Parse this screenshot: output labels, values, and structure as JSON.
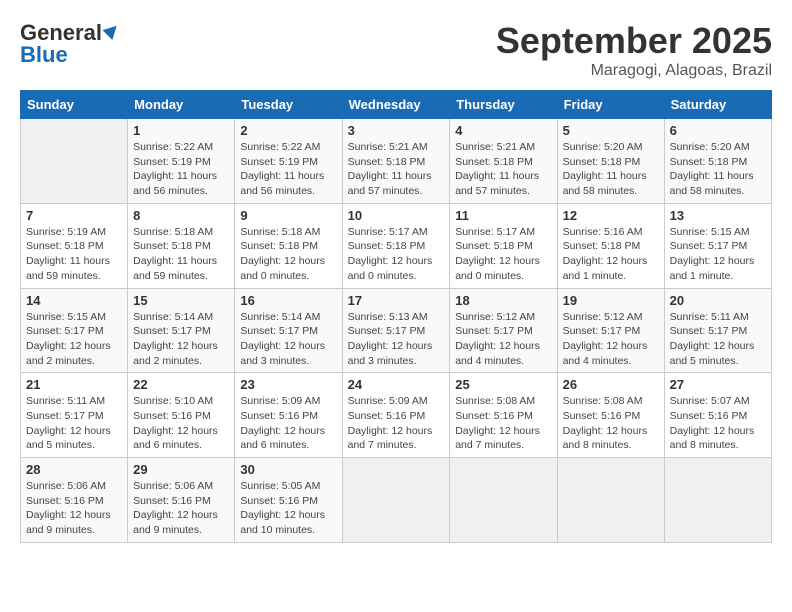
{
  "header": {
    "logo_general": "General",
    "logo_blue": "Blue",
    "month_title": "September 2025",
    "location": "Maragogi, Alagoas, Brazil"
  },
  "columns": [
    "Sunday",
    "Monday",
    "Tuesday",
    "Wednesday",
    "Thursday",
    "Friday",
    "Saturday"
  ],
  "weeks": [
    [
      {
        "day": "",
        "sunrise": "",
        "sunset": "",
        "daylight": ""
      },
      {
        "day": "1",
        "sunrise": "5:22 AM",
        "sunset": "5:19 PM",
        "daylight": "11 hours and 56 minutes."
      },
      {
        "day": "2",
        "sunrise": "5:22 AM",
        "sunset": "5:19 PM",
        "daylight": "11 hours and 56 minutes."
      },
      {
        "day": "3",
        "sunrise": "5:21 AM",
        "sunset": "5:18 PM",
        "daylight": "11 hours and 57 minutes."
      },
      {
        "day": "4",
        "sunrise": "5:21 AM",
        "sunset": "5:18 PM",
        "daylight": "11 hours and 57 minutes."
      },
      {
        "day": "5",
        "sunrise": "5:20 AM",
        "sunset": "5:18 PM",
        "daylight": "11 hours and 58 minutes."
      },
      {
        "day": "6",
        "sunrise": "5:20 AM",
        "sunset": "5:18 PM",
        "daylight": "11 hours and 58 minutes."
      }
    ],
    [
      {
        "day": "7",
        "sunrise": "5:19 AM",
        "sunset": "5:18 PM",
        "daylight": "11 hours and 59 minutes."
      },
      {
        "day": "8",
        "sunrise": "5:18 AM",
        "sunset": "5:18 PM",
        "daylight": "11 hours and 59 minutes."
      },
      {
        "day": "9",
        "sunrise": "5:18 AM",
        "sunset": "5:18 PM",
        "daylight": "12 hours and 0 minutes."
      },
      {
        "day": "10",
        "sunrise": "5:17 AM",
        "sunset": "5:18 PM",
        "daylight": "12 hours and 0 minutes."
      },
      {
        "day": "11",
        "sunrise": "5:17 AM",
        "sunset": "5:18 PM",
        "daylight": "12 hours and 0 minutes."
      },
      {
        "day": "12",
        "sunrise": "5:16 AM",
        "sunset": "5:18 PM",
        "daylight": "12 hours and 1 minute."
      },
      {
        "day": "13",
        "sunrise": "5:15 AM",
        "sunset": "5:17 PM",
        "daylight": "12 hours and 1 minute."
      }
    ],
    [
      {
        "day": "14",
        "sunrise": "5:15 AM",
        "sunset": "5:17 PM",
        "daylight": "12 hours and 2 minutes."
      },
      {
        "day": "15",
        "sunrise": "5:14 AM",
        "sunset": "5:17 PM",
        "daylight": "12 hours and 2 minutes."
      },
      {
        "day": "16",
        "sunrise": "5:14 AM",
        "sunset": "5:17 PM",
        "daylight": "12 hours and 3 minutes."
      },
      {
        "day": "17",
        "sunrise": "5:13 AM",
        "sunset": "5:17 PM",
        "daylight": "12 hours and 3 minutes."
      },
      {
        "day": "18",
        "sunrise": "5:12 AM",
        "sunset": "5:17 PM",
        "daylight": "12 hours and 4 minutes."
      },
      {
        "day": "19",
        "sunrise": "5:12 AM",
        "sunset": "5:17 PM",
        "daylight": "12 hours and 4 minutes."
      },
      {
        "day": "20",
        "sunrise": "5:11 AM",
        "sunset": "5:17 PM",
        "daylight": "12 hours and 5 minutes."
      }
    ],
    [
      {
        "day": "21",
        "sunrise": "5:11 AM",
        "sunset": "5:17 PM",
        "daylight": "12 hours and 5 minutes."
      },
      {
        "day": "22",
        "sunrise": "5:10 AM",
        "sunset": "5:16 PM",
        "daylight": "12 hours and 6 minutes."
      },
      {
        "day": "23",
        "sunrise": "5:09 AM",
        "sunset": "5:16 PM",
        "daylight": "12 hours and 6 minutes."
      },
      {
        "day": "24",
        "sunrise": "5:09 AM",
        "sunset": "5:16 PM",
        "daylight": "12 hours and 7 minutes."
      },
      {
        "day": "25",
        "sunrise": "5:08 AM",
        "sunset": "5:16 PM",
        "daylight": "12 hours and 7 minutes."
      },
      {
        "day": "26",
        "sunrise": "5:08 AM",
        "sunset": "5:16 PM",
        "daylight": "12 hours and 8 minutes."
      },
      {
        "day": "27",
        "sunrise": "5:07 AM",
        "sunset": "5:16 PM",
        "daylight": "12 hours and 8 minutes."
      }
    ],
    [
      {
        "day": "28",
        "sunrise": "5:06 AM",
        "sunset": "5:16 PM",
        "daylight": "12 hours and 9 minutes."
      },
      {
        "day": "29",
        "sunrise": "5:06 AM",
        "sunset": "5:16 PM",
        "daylight": "12 hours and 9 minutes."
      },
      {
        "day": "30",
        "sunrise": "5:05 AM",
        "sunset": "5:16 PM",
        "daylight": "12 hours and 10 minutes."
      },
      {
        "day": "",
        "sunrise": "",
        "sunset": "",
        "daylight": ""
      },
      {
        "day": "",
        "sunrise": "",
        "sunset": "",
        "daylight": ""
      },
      {
        "day": "",
        "sunrise": "",
        "sunset": "",
        "daylight": ""
      },
      {
        "day": "",
        "sunrise": "",
        "sunset": "",
        "daylight": ""
      }
    ]
  ]
}
